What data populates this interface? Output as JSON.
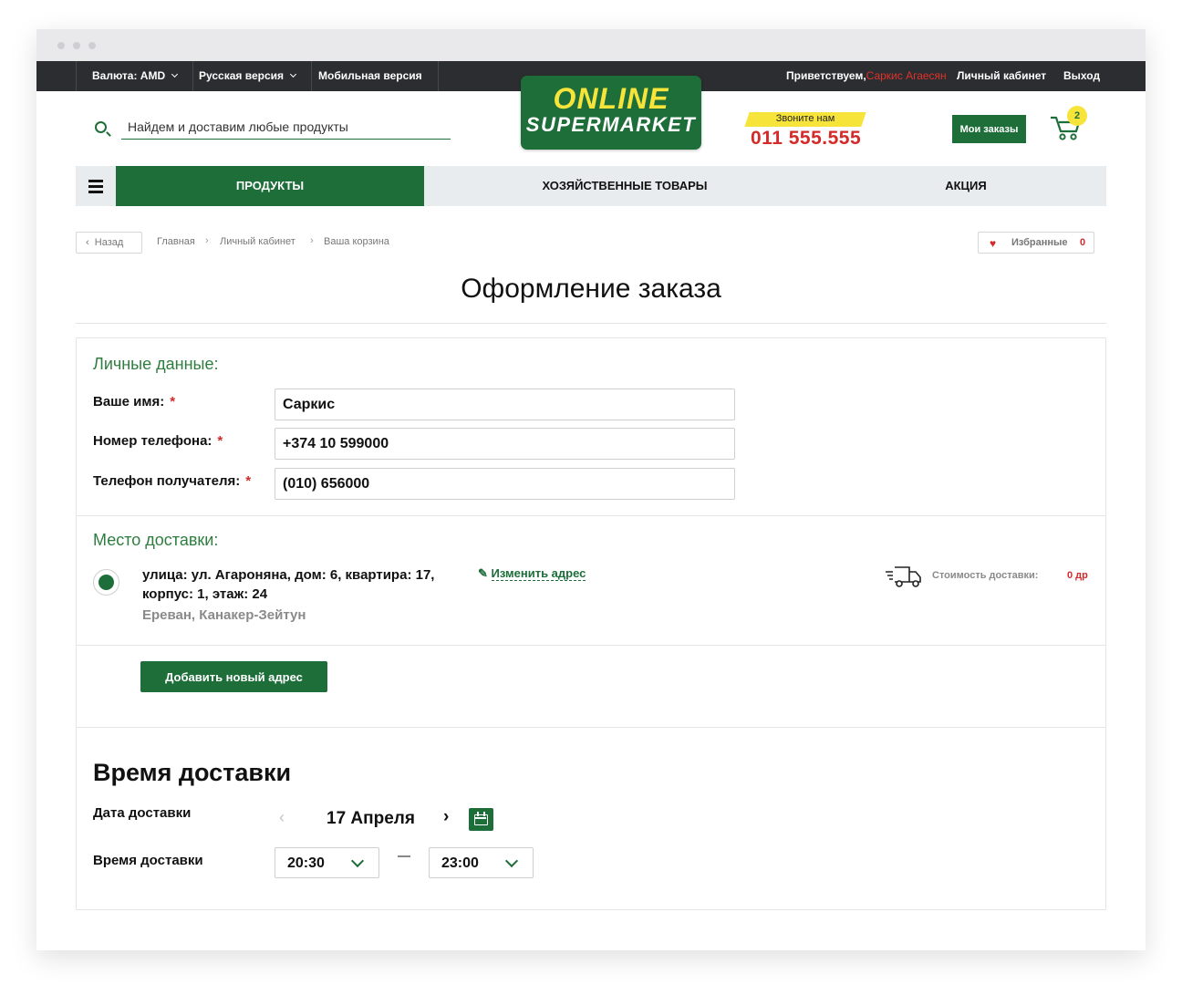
{
  "topbar": {
    "currency": "Валюта: AMD",
    "language": "Русская версия",
    "mobile": "Мобильная версия",
    "greeting": "Приветствуем,",
    "user_name": "Саркис Агаесян",
    "account": "Личный кабинет",
    "logout": "Выход"
  },
  "header": {
    "search_placeholder": "Найдем и доставим любые продукты",
    "logo_line1": "ONLINE",
    "logo_line2": "SUPERMARKET",
    "call_label": "Звоните нам",
    "phone": "011 555.555",
    "orders_label": "Мои заказы",
    "cart_count": "2"
  },
  "nav": {
    "items": [
      {
        "label": "ПРОДУКТЫ",
        "active": true
      },
      {
        "label": "ХОЗЯЙСТВЕННЫЕ ТОВАРЫ",
        "active": false
      },
      {
        "label": "АКЦИЯ",
        "active": false
      }
    ]
  },
  "breadcrumb": {
    "back": "Назад",
    "items": [
      "Главная",
      "Личный кабинет",
      "Ваша корзина"
    ],
    "favorites_label": "Избранные",
    "favorites_count": "0"
  },
  "page": {
    "title": "Оформление заказа"
  },
  "personal": {
    "title": "Личные данные:",
    "fields": [
      {
        "label": "Ваше имя:",
        "value": "Саркис"
      },
      {
        "label": "Номер телефона:",
        "value": "+374 10 599000"
      },
      {
        "label": "Телефон получателя:",
        "value": "(010) 656000"
      }
    ],
    "required_mark": "*"
  },
  "delivery_place": {
    "title": "Место доставки:",
    "address_line1": "улица: ул. Агароняна, дом: 6, квартира: 17,",
    "address_line2": "корпус: 1, этаж: 24",
    "city": "Ереван, Канакер-Зейтун",
    "edit_label": "Изменить адрес",
    "cost_label": "Стоимость доставки:",
    "cost_value": "0 др",
    "add_label": "Добавить новый адрес"
  },
  "delivery_time": {
    "title": "Время доставки",
    "date_label": "Дата доставки",
    "date_value": "17 Апреля",
    "time_label": "Время доставки",
    "time_from": "20:30",
    "time_to": "23:00"
  },
  "colors": {
    "brand_green": "#1e6e3a",
    "accent_yellow": "#f6e43a",
    "accent_red": "#d32a2a",
    "topbar_dark": "#2b2d30"
  }
}
